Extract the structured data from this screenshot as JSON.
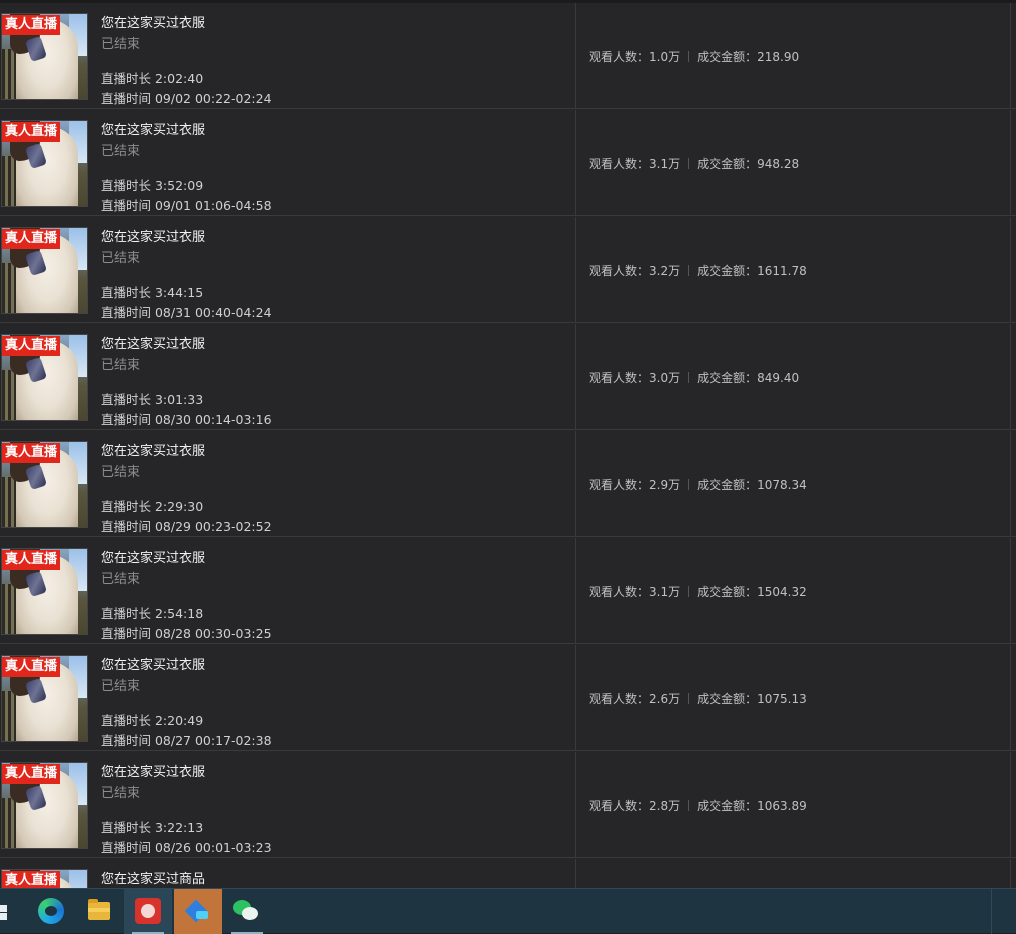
{
  "list": {
    "badge_label": "真人直播",
    "stats_labels": {
      "viewers": "观看人数：",
      "amount": "成交金额："
    },
    "items": [
      {
        "title": "您在这家买过衣服",
        "status": "已结束",
        "duration": "直播时长 2:02:40",
        "time": "直播时间 09/02 00:22-02:24",
        "viewers": "1.0万",
        "amount": "218.90"
      },
      {
        "title": "您在这家买过衣服",
        "status": "已结束",
        "duration": "直播时长 3:52:09",
        "time": "直播时间 09/01 01:06-04:58",
        "viewers": "3.1万",
        "amount": "948.28"
      },
      {
        "title": "您在这家买过衣服",
        "status": "已结束",
        "duration": "直播时长 3:44:15",
        "time": "直播时间 08/31 00:40-04:24",
        "viewers": "3.2万",
        "amount": "1611.78"
      },
      {
        "title": "您在这家买过衣服",
        "status": "已结束",
        "duration": "直播时长 3:01:33",
        "time": "直播时间 08/30 00:14-03:16",
        "viewers": "3.0万",
        "amount": "849.40"
      },
      {
        "title": "您在这家买过衣服",
        "status": "已结束",
        "duration": "直播时长 2:29:30",
        "time": "直播时间 08/29 00:23-02:52",
        "viewers": "2.9万",
        "amount": "1078.34"
      },
      {
        "title": "您在这家买过衣服",
        "status": "已结束",
        "duration": "直播时长 2:54:18",
        "time": "直播时间 08/28 00:30-03:25",
        "viewers": "3.1万",
        "amount": "1504.32"
      },
      {
        "title": "您在这家买过衣服",
        "status": "已结束",
        "duration": "直播时长 2:20:49",
        "time": "直播时间 08/27 00:17-02:38",
        "viewers": "2.6万",
        "amount": "1075.13"
      },
      {
        "title": "您在这家买过衣服",
        "status": "已结束",
        "duration": "直播时长 3:22:13",
        "time": "直播时间 08/26 00:01-03:23",
        "viewers": "2.8万",
        "amount": "1063.89"
      },
      {
        "title": "您在这家买过商品"
      }
    ]
  },
  "taskbar": {
    "apps": [
      {
        "icon": "windows-start-icon"
      },
      {
        "icon": "edge-browser-icon"
      },
      {
        "icon": "file-explorer-icon"
      },
      {
        "icon": "red-app-icon",
        "state": "open"
      },
      {
        "icon": "blue-app-icon",
        "state": "active"
      },
      {
        "icon": "wechat-icon",
        "state": "open"
      }
    ]
  }
}
